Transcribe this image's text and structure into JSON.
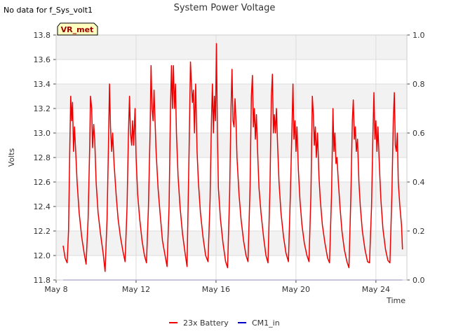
{
  "no_data_message": "No data for f_Sys_volt1",
  "chart_data": {
    "type": "line",
    "title": "System Power Voltage",
    "xlabel": "Time",
    "ylabel": "Volts",
    "badge": "VR_met",
    "x_range": [
      "May 8",
      "May 25.4"
    ],
    "ylim": [
      11.8,
      13.8
    ],
    "y2lim": [
      0.0,
      1.0
    ],
    "y_ticks": [
      "11.8",
      "12.0",
      "12.2",
      "12.4",
      "12.6",
      "12.8",
      "13.0",
      "13.2",
      "13.4",
      "13.6",
      "13.8"
    ],
    "y2_ticks": [
      "0.0",
      "0.2",
      "0.4",
      "0.6",
      "0.8",
      "1.0"
    ],
    "x_ticks": [
      {
        "label": "May 8",
        "day": 8
      },
      {
        "label": "May 12",
        "day": 12
      },
      {
        "label": "May 16",
        "day": 16
      },
      {
        "label": "May 20",
        "day": 20
      },
      {
        "label": "May 24",
        "day": 24
      }
    ],
    "grid": true,
    "band_colors": [
      "#f2f2f2",
      "#ffffff"
    ],
    "legend_position": "bottom-center",
    "series": [
      {
        "name": "23x Battery",
        "color": "#ee0000",
        "axis": "left",
        "points": [
          [
            8.35,
            12.08
          ],
          [
            8.45,
            11.98
          ],
          [
            8.55,
            11.94
          ],
          [
            8.62,
            12.2
          ],
          [
            8.68,
            12.85
          ],
          [
            8.73,
            13.3
          ],
          [
            8.78,
            13.1
          ],
          [
            8.82,
            13.25
          ],
          [
            8.87,
            12.85
          ],
          [
            8.92,
            13.05
          ],
          [
            8.98,
            12.85
          ],
          [
            9.05,
            12.6
          ],
          [
            9.15,
            12.35
          ],
          [
            9.28,
            12.15
          ],
          [
            9.4,
            12.02
          ],
          [
            9.5,
            11.93
          ],
          [
            9.6,
            12.3
          ],
          [
            9.68,
            12.9
          ],
          [
            9.72,
            13.3
          ],
          [
            9.78,
            13.2
          ],
          [
            9.82,
            12.88
          ],
          [
            9.88,
            13.07
          ],
          [
            9.93,
            12.95
          ],
          [
            10.0,
            12.6
          ],
          [
            10.1,
            12.35
          ],
          [
            10.22,
            12.18
          ],
          [
            10.35,
            12.02
          ],
          [
            10.45,
            11.87
          ],
          [
            10.55,
            12.3
          ],
          [
            10.62,
            12.9
          ],
          [
            10.67,
            13.4
          ],
          [
            10.72,
            13.05
          ],
          [
            10.78,
            12.85
          ],
          [
            10.83,
            13.0
          ],
          [
            10.9,
            12.75
          ],
          [
            11.0,
            12.5
          ],
          [
            11.1,
            12.3
          ],
          [
            11.22,
            12.15
          ],
          [
            11.35,
            12.03
          ],
          [
            11.45,
            11.95
          ],
          [
            11.55,
            12.4
          ],
          [
            11.62,
            13.0
          ],
          [
            11.67,
            13.3
          ],
          [
            11.72,
            13.0
          ],
          [
            11.78,
            12.9
          ],
          [
            11.83,
            13.1
          ],
          [
            11.88,
            12.9
          ],
          [
            11.95,
            13.2
          ],
          [
            12.0,
            12.8
          ],
          [
            12.08,
            12.5
          ],
          [
            12.18,
            12.3
          ],
          [
            12.3,
            12.12
          ],
          [
            12.42,
            12.0
          ],
          [
            12.52,
            11.94
          ],
          [
            12.62,
            12.4
          ],
          [
            12.7,
            13.0
          ],
          [
            12.75,
            13.55
          ],
          [
            12.8,
            13.2
          ],
          [
            12.85,
            13.1
          ],
          [
            12.9,
            13.35
          ],
          [
            12.95,
            13.1
          ],
          [
            13.0,
            12.85
          ],
          [
            13.1,
            12.55
          ],
          [
            13.2,
            12.35
          ],
          [
            13.32,
            12.12
          ],
          [
            13.45,
            12.0
          ],
          [
            13.55,
            11.91
          ],
          [
            13.65,
            12.4
          ],
          [
            13.72,
            13.2
          ],
          [
            13.77,
            13.55
          ],
          [
            13.82,
            13.2
          ],
          [
            13.87,
            13.55
          ],
          [
            13.92,
            13.2
          ],
          [
            13.97,
            13.4
          ],
          [
            14.02,
            13.0
          ],
          [
            14.1,
            12.65
          ],
          [
            14.2,
            12.4
          ],
          [
            14.32,
            12.18
          ],
          [
            14.45,
            12.02
          ],
          [
            14.55,
            11.91
          ],
          [
            14.65,
            12.85
          ],
          [
            14.72,
            13.58
          ],
          [
            14.77,
            13.4
          ],
          [
            14.82,
            13.25
          ],
          [
            14.87,
            13.35
          ],
          [
            14.92,
            13.0
          ],
          [
            14.98,
            13.4
          ],
          [
            15.05,
            12.85
          ],
          [
            15.12,
            12.6
          ],
          [
            15.22,
            12.35
          ],
          [
            15.35,
            12.15
          ],
          [
            15.48,
            12.0
          ],
          [
            15.6,
            11.95
          ],
          [
            15.7,
            12.45
          ],
          [
            15.77,
            13.1
          ],
          [
            15.82,
            13.4
          ],
          [
            15.87,
            13.0
          ],
          [
            15.92,
            13.3
          ],
          [
            15.97,
            13.1
          ],
          [
            16.02,
            13.73
          ],
          [
            16.07,
            13.0
          ],
          [
            16.12,
            12.55
          ],
          [
            16.22,
            12.3
          ],
          [
            16.35,
            12.1
          ],
          [
            16.48,
            11.95
          ],
          [
            16.58,
            11.9
          ],
          [
            16.68,
            12.5
          ],
          [
            16.75,
            13.2
          ],
          [
            16.8,
            13.52
          ],
          [
            16.85,
            13.1
          ],
          [
            16.9,
            13.05
          ],
          [
            16.95,
            13.28
          ],
          [
            17.0,
            13.1
          ],
          [
            17.05,
            12.8
          ],
          [
            17.15,
            12.5
          ],
          [
            17.25,
            12.3
          ],
          [
            17.38,
            12.12
          ],
          [
            17.5,
            12.0
          ],
          [
            17.6,
            11.95
          ],
          [
            17.7,
            12.55
          ],
          [
            17.77,
            13.3
          ],
          [
            17.82,
            13.47
          ],
          [
            17.87,
            13.05
          ],
          [
            17.92,
            13.2
          ],
          [
            17.97,
            12.95
          ],
          [
            18.02,
            13.15
          ],
          [
            18.08,
            12.85
          ],
          [
            18.15,
            12.55
          ],
          [
            18.25,
            12.35
          ],
          [
            18.38,
            12.15
          ],
          [
            18.5,
            12.0
          ],
          [
            18.6,
            11.94
          ],
          [
            18.7,
            12.55
          ],
          [
            18.77,
            13.3
          ],
          [
            18.82,
            13.48
          ],
          [
            18.87,
            13.0
          ],
          [
            18.92,
            13.15
          ],
          [
            18.97,
            13.0
          ],
          [
            19.02,
            13.2
          ],
          [
            19.08,
            12.9
          ],
          [
            19.15,
            12.6
          ],
          [
            19.25,
            12.35
          ],
          [
            19.38,
            12.15
          ],
          [
            19.5,
            12.02
          ],
          [
            19.62,
            11.95
          ],
          [
            19.72,
            12.5
          ],
          [
            19.8,
            13.05
          ],
          [
            19.85,
            13.4
          ],
          [
            19.9,
            12.95
          ],
          [
            19.95,
            13.1
          ],
          [
            20.0,
            12.85
          ],
          [
            20.05,
            13.05
          ],
          [
            20.12,
            12.7
          ],
          [
            20.2,
            12.45
          ],
          [
            20.3,
            12.25
          ],
          [
            20.42,
            12.1
          ],
          [
            20.55,
            12.0
          ],
          [
            20.65,
            11.95
          ],
          [
            20.75,
            12.5
          ],
          [
            20.82,
            13.3
          ],
          [
            20.87,
            13.15
          ],
          [
            20.92,
            12.9
          ],
          [
            20.97,
            13.05
          ],
          [
            21.02,
            12.8
          ],
          [
            21.08,
            13.0
          ],
          [
            21.15,
            12.65
          ],
          [
            21.22,
            12.45
          ],
          [
            21.32,
            12.25
          ],
          [
            21.45,
            12.1
          ],
          [
            21.58,
            11.98
          ],
          [
            21.68,
            11.94
          ],
          [
            21.78,
            12.5
          ],
          [
            21.85,
            13.2
          ],
          [
            21.9,
            12.85
          ],
          [
            21.95,
            13.0
          ],
          [
            22.0,
            12.75
          ],
          [
            22.05,
            12.8
          ],
          [
            22.12,
            12.6
          ],
          [
            22.2,
            12.4
          ],
          [
            22.3,
            12.2
          ],
          [
            22.42,
            12.05
          ],
          [
            22.55,
            11.95
          ],
          [
            22.65,
            11.9
          ],
          [
            22.75,
            12.5
          ],
          [
            22.82,
            13.1
          ],
          [
            22.87,
            13.27
          ],
          [
            22.92,
            12.95
          ],
          [
            22.97,
            13.05
          ],
          [
            23.02,
            12.85
          ],
          [
            23.08,
            12.95
          ],
          [
            23.15,
            12.6
          ],
          [
            23.22,
            12.4
          ],
          [
            23.32,
            12.2
          ],
          [
            23.45,
            12.05
          ],
          [
            23.58,
            11.95
          ],
          [
            23.68,
            11.94
          ],
          [
            23.78,
            12.4
          ],
          [
            23.85,
            13.0
          ],
          [
            23.9,
            13.33
          ],
          [
            23.95,
            12.95
          ],
          [
            24.0,
            13.1
          ],
          [
            24.05,
            12.85
          ],
          [
            24.1,
            13.05
          ],
          [
            24.18,
            12.7
          ],
          [
            24.25,
            12.45
          ],
          [
            24.35,
            12.22
          ],
          [
            24.48,
            12.05
          ],
          [
            24.6,
            11.96
          ],
          [
            24.7,
            11.94
          ],
          [
            24.8,
            12.5
          ],
          [
            24.87,
            13.1
          ],
          [
            24.92,
            13.33
          ],
          [
            24.97,
            12.9
          ],
          [
            25.02,
            12.85
          ],
          [
            25.07,
            13.0
          ],
          [
            25.12,
            12.6
          ],
          [
            25.2,
            12.4
          ],
          [
            25.28,
            12.25
          ],
          [
            25.33,
            12.05
          ]
        ]
      },
      {
        "name": "CM1_in",
        "color": "#0000cc",
        "axis": "right",
        "points": [
          [
            8.35,
            0.0
          ],
          [
            25.33,
            0.0
          ]
        ]
      }
    ]
  }
}
